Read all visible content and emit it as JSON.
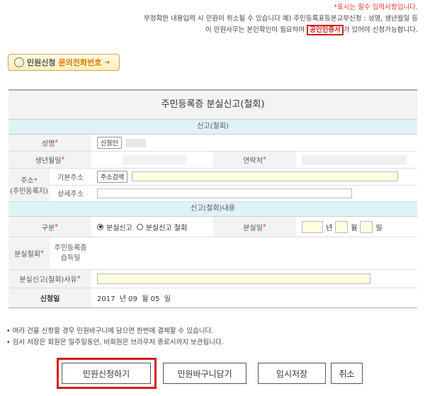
{
  "notice": {
    "line1": "*표시는 필수 입력사항입니다.",
    "line2": "부정확한 내용입력 시 민원이 취소될 수 있습니다  예) 주민등록표등본교부신청 : 성명, 생년월일 등",
    "line3_pre": "이 민원사무는 본인확인이 필요하여",
    "line3_highlight": "공인인증서",
    "line3_post": "가 있어야 신청가능합니다."
  },
  "contact_button": {
    "label_a": "민원신청",
    "label_b": "문의전화번호"
  },
  "form": {
    "title": "주민등록증 분실신고(철회)",
    "section1": "신고(철회)",
    "name_label": "성명",
    "applicant_button": "신청인",
    "birth_label": "생년월일",
    "contact_label": "연락처",
    "address_label": "주소",
    "address_sub": "(주민등록지)",
    "basic_address_label": "기본주소",
    "address_search_button": "주소검색",
    "detail_address_label": "상세주소",
    "section2": "신고(철회)내용",
    "type_label": "구분",
    "option_lost": "분실신고",
    "option_withdraw": "분실신고 철회",
    "lost_date_label": "분실일",
    "unit_year": "년",
    "unit_month": "월",
    "unit_day": "일",
    "withdraw_label": "분실철회",
    "id_acquired_label": "주민등록증 습득일",
    "reason_label": "분실신고(철회)사유",
    "apply_date_label": "신청일",
    "apply_date_value": "2017  년 09  월 05  일",
    "required_mark": "*"
  },
  "notes": [
    "• 여러 건을 신청할 경우 민원바구니에 담으면 한번에 결제할 수 있습니다.",
    "• 임시 저장은 회원은 일주일동안, 비회원은 브라우저 종료시까지 보관됩니다."
  ],
  "buttons": {
    "apply": "민원신청하기",
    "basket": "민원바구니담기",
    "temp_save": "임시저장",
    "cancel": "취소"
  },
  "colors": {
    "highlight_red": "#d81b1b",
    "section_bg": "#dff2f5",
    "input_yellow": "#ffffe0"
  }
}
